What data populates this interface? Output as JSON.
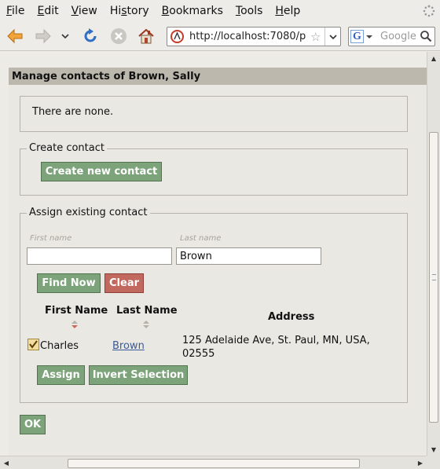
{
  "menu": [
    {
      "label": "File",
      "key": "F",
      "rest": "ile"
    },
    {
      "label": "Edit",
      "key": "E",
      "rest": "dit"
    },
    {
      "label": "View",
      "key": "V",
      "rest": "iew"
    },
    {
      "label": "History",
      "key": "s",
      "pre": "Hi",
      "rest": "tory"
    },
    {
      "label": "Bookmarks",
      "key": "B",
      "rest": "ookmarks"
    },
    {
      "label": "Tools",
      "key": "T",
      "rest": "ools"
    },
    {
      "label": "Help",
      "key": "H",
      "rest": "elp"
    }
  ],
  "toolbar": {
    "back_icon": "back-arrow-icon",
    "forward_icon": "forward-arrow-icon",
    "reload_icon": "reload-icon",
    "stop_icon": "stop-icon",
    "home_icon": "home-icon",
    "url": "http://localhost:7080/p",
    "search_placeholder": "Google"
  },
  "page": {
    "header": "Manage contacts of Brown, Sally",
    "existing_message": "There are none.",
    "create": {
      "legend": "Create contact",
      "button": "Create new contact"
    },
    "assign": {
      "legend": "Assign existing contact",
      "first_name_label": "First name",
      "last_name_label": "Last name",
      "first_name_value": "",
      "last_name_value": "Brown",
      "find_button": "Find Now",
      "clear_button": "Clear",
      "columns": [
        "First Name",
        "Last Name",
        "Address"
      ],
      "rows": [
        {
          "checked": true,
          "first_name": "Charles",
          "last_name": "Brown",
          "address_line1": "125 Adelaide Ave, St. Paul, MN, USA,",
          "address_line2": "02555"
        }
      ],
      "assign_button": "Assign",
      "invert_button": "Invert Selection"
    },
    "ok_button": "OK"
  },
  "colors": {
    "green_button": "#7ca37a",
    "red_button": "#c1685f",
    "header_bar": "#bdb8ae",
    "link": "#3a5b97"
  }
}
